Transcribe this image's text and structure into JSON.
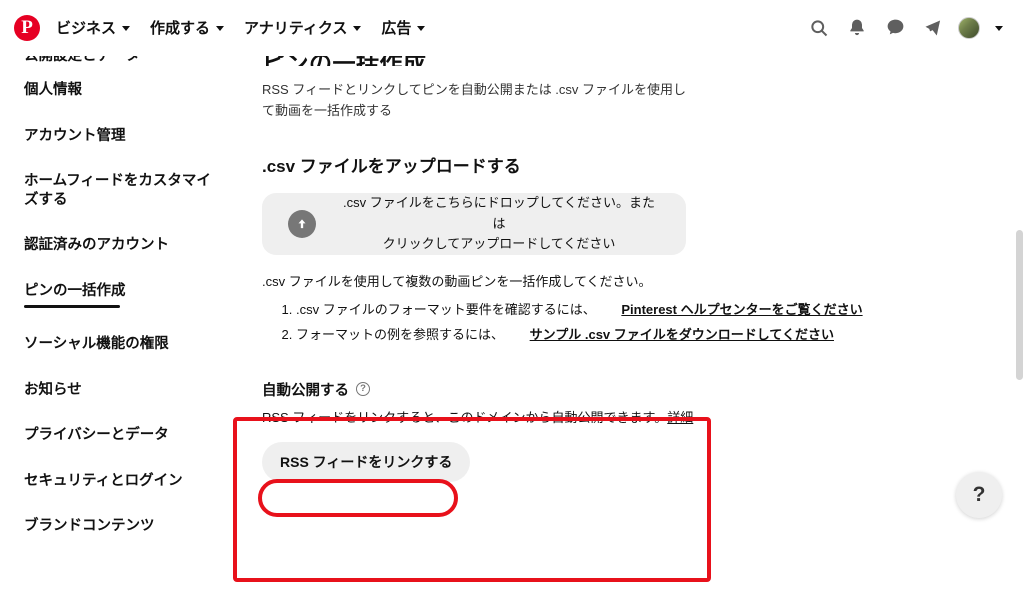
{
  "topnav": {
    "logo_icon": "pinterest-logo-icon",
    "items": [
      {
        "label": "ビジネス",
        "caret": true
      },
      {
        "label": "作成する",
        "caret": true
      },
      {
        "label": "アナリティクス",
        "caret": true
      },
      {
        "label": "広告",
        "caret": true
      }
    ],
    "right_icons": [
      "search-icon",
      "bell-icon",
      "chat-bubble-icon",
      "megaphone-icon",
      "avatar",
      "chevron-down-icon"
    ]
  },
  "sidebar": {
    "items": [
      {
        "label": "公開設定とデータ",
        "clipped": true,
        "active": false
      },
      {
        "label": "個人情報",
        "active": false
      },
      {
        "label": "アカウント管理",
        "active": false
      },
      {
        "label": "ホームフィードをカスタマイズする",
        "active": false
      },
      {
        "label": "認証済みのアカウント",
        "active": false
      },
      {
        "label": "ピンの一括作成",
        "active": true
      },
      {
        "label": "ソーシャル機能の権限",
        "active": false
      },
      {
        "label": "お知らせ",
        "active": false
      },
      {
        "label": "プライバシーとデータ",
        "active": false
      },
      {
        "label": "セキュリティとログイン",
        "active": false
      },
      {
        "label": "ブランドコンテンツ",
        "active": false
      }
    ]
  },
  "main": {
    "title": "ピンの一括作成",
    "subtitle": "RSS フィードとリンクしてピンを自動公開または .csv ファイルを使用して動画を一括作成する",
    "upload_section": {
      "heading": ".csv ファイルをアップロードする",
      "dropzone_icon": "upload-arrow-icon",
      "dropzone_text_line1": ".csv ファイルをこちらにドロップしてください。または",
      "dropzone_text_line2": "クリックしてアップロードしてください"
    },
    "note": ".csv ファイルを使用して複数の動画ピンを一括作成してください。",
    "steps": [
      {
        "text": ".csv ファイルのフォーマット要件を確認するには、",
        "link": "Pinterest ヘルプセンターをご覧ください"
      },
      {
        "text": "フォーマットの例を参照するには、",
        "link": "サンプル .csv ファイルをダウンロードしてください"
      }
    ],
    "auto_publish": {
      "title": "自動公開する",
      "help_icon": "question-mark-icon",
      "description": "RSS フィードをリンクすると、このドメインから自動公開できます。",
      "description_link": "詳細",
      "button_label": "RSS フィードをリンクする"
    }
  },
  "help_fab": {
    "label": "?",
    "icon": "question-mark-icon"
  },
  "annotations": [
    {
      "name": "auto-publish-highlight"
    },
    {
      "name": "rss-button-highlight"
    }
  ],
  "colors": {
    "brand_red": "#e60023",
    "annotation_red": "#e8111b",
    "panel_gray": "#efefef",
    "text": "#111111"
  }
}
